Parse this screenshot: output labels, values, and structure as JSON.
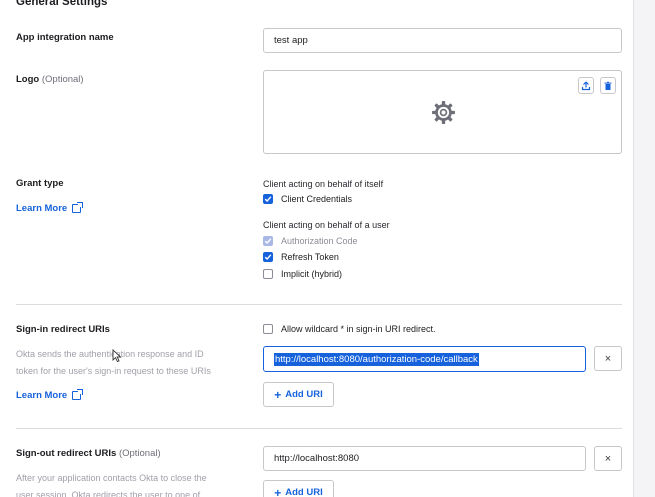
{
  "section_title": "General Settings",
  "app_name": {
    "label": "App integration name",
    "value": "test app"
  },
  "logo": {
    "label": "Logo",
    "optional": "(Optional)"
  },
  "grant_type": {
    "label": "Grant type",
    "learn_more": "Learn More",
    "group1_title": "Client acting on behalf of itself",
    "client_credentials": "Client Credentials",
    "group2_title": "Client acting on behalf of a user",
    "authorization_code": "Authorization Code",
    "refresh_token": "Refresh Token",
    "implicit": "Implicit (hybrid)"
  },
  "sign_in": {
    "label": "Sign-in redirect URIs",
    "wildcard_label": "Allow wildcard * in sign-in URI redirect.",
    "desc_line1": "Okta sends the authentication response and ID",
    "desc_line2": "token for the user's sign-in request to these URIs",
    "learn_more": "Learn More",
    "uri_value": "http://localhost:8080/authorization-code/callback",
    "add_uri": "Add URI",
    "remove": "×"
  },
  "sign_out": {
    "label": "Sign-out redirect URIs",
    "optional": "(Optional)",
    "desc_line1": "After your application contacts Okta to close the",
    "desc_line2": "user session, Okta redirects the user to one of",
    "uri_value": "http://localhost:8080",
    "add_uri": "Add URI",
    "remove": "×"
  },
  "colors": {
    "accent": "#1662dd",
    "border": "#c7c7cc"
  }
}
